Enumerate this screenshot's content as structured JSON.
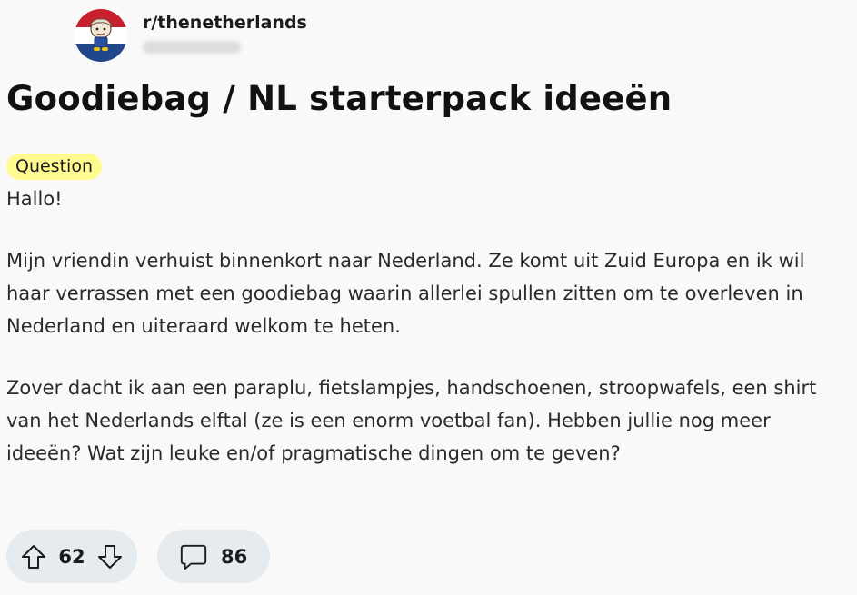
{
  "post": {
    "subreddit": "r/thenetherlands",
    "title": "Goodiebag / NL starterpack ideeën",
    "flair": "Question",
    "flair_color": "#fffb8f",
    "paragraphs": [
      "Hallo!",
      "Mijn vriendin verhuist binnenkort naar Nederland. Ze komt uit Zuid Europa en ik wil haar verrassen met een goodiebag waarin allerlei spullen zitten om te overleven in Nederland en uiteraard welkom te heten.",
      "Zover dacht ik aan een paraplu, fietslampjes, handschoenen, stroopwafels, een shirt van het Nederlands elftal (ze is een enorm voetbal fan). Hebben jullie nog meer ideeën? Wat zijn leuke en/of pragmatische dingen om te geven?"
    ]
  },
  "actions": {
    "upvote_icon": "arrow-up-icon",
    "downvote_icon": "arrow-down-icon",
    "vote_count": "62",
    "comment_icon": "speech-bubble-icon",
    "comment_count": "86",
    "pill_color": "#e5ebee"
  },
  "avatar": {
    "icon": "dutch-flag-mascot-icon",
    "colors": [
      "#c8202e",
      "#ffffff",
      "#21468b"
    ]
  }
}
